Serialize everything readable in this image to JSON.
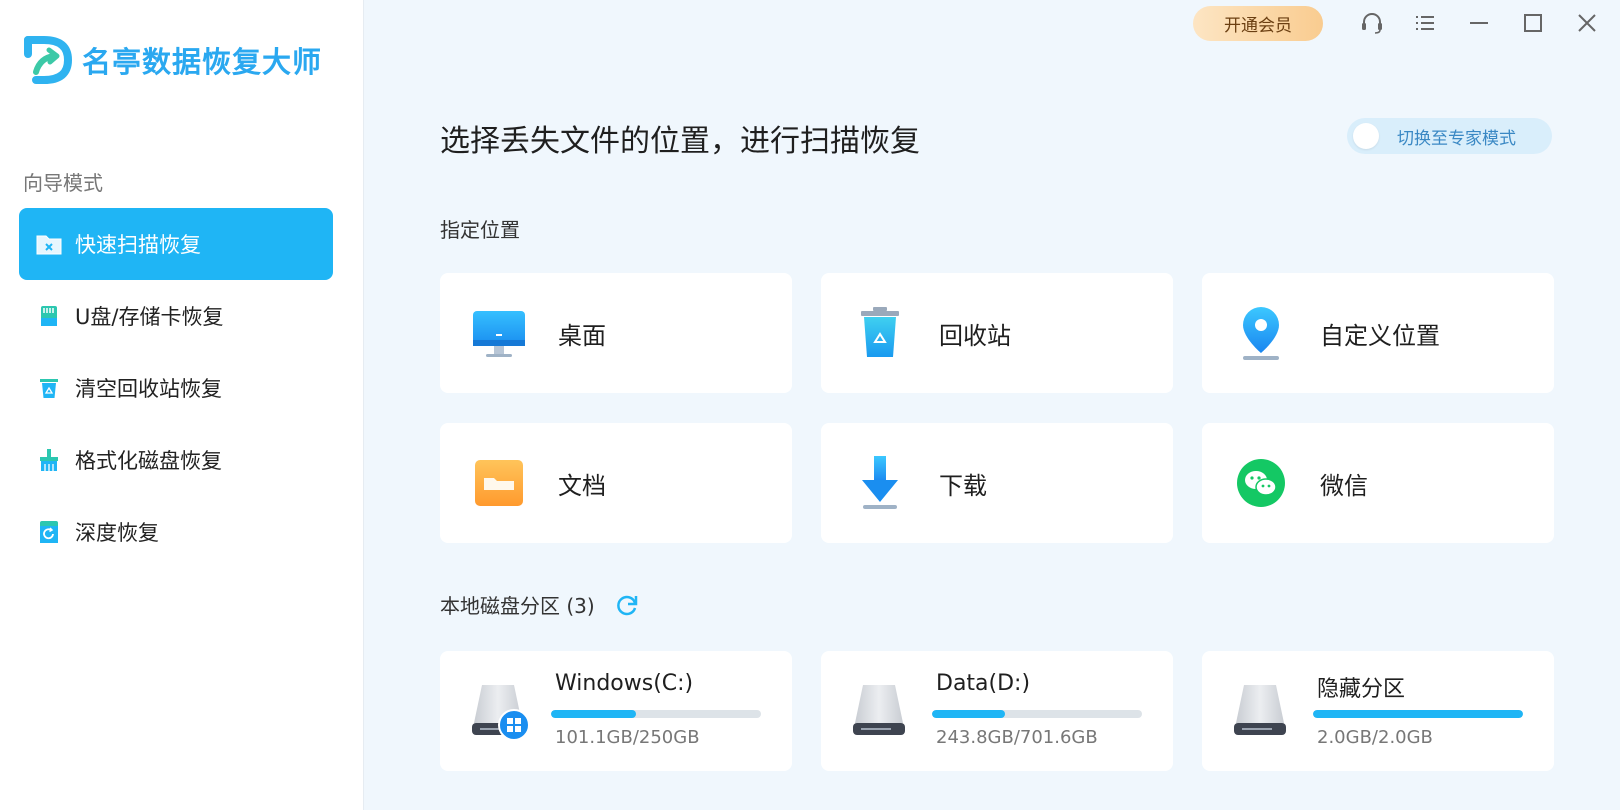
{
  "app": {
    "title": "名亭数据恢复大师"
  },
  "titlebar": {
    "vip_label": "开通会员"
  },
  "sidebar": {
    "section_label": "向导模式",
    "items": [
      {
        "label": "快速扫描恢复",
        "icon": "folder-scan-icon",
        "active": true
      },
      {
        "label": "U盘/存储卡恢复",
        "icon": "sd-card-icon",
        "active": false
      },
      {
        "label": "清空回收站恢复",
        "icon": "recycle-bin-icon",
        "active": false
      },
      {
        "label": "格式化磁盘恢复",
        "icon": "broom-icon",
        "active": false
      },
      {
        "label": "深度恢复",
        "icon": "deep-recovery-icon",
        "active": false
      }
    ]
  },
  "main": {
    "title": "选择丢失文件的位置，进行扫描恢复",
    "expert_toggle_label": "切换至专家模式",
    "locations_heading": "指定位置",
    "locations": [
      {
        "label": "桌面",
        "icon": "desktop-icon"
      },
      {
        "label": "回收站",
        "icon": "recycle-bin-icon"
      },
      {
        "label": "自定义位置",
        "icon": "location-pin-icon"
      },
      {
        "label": "文档",
        "icon": "folder-icon"
      },
      {
        "label": "下载",
        "icon": "download-icon"
      },
      {
        "label": "微信",
        "icon": "wechat-icon"
      }
    ],
    "disks_heading": "本地磁盘分区 (3)",
    "disks": [
      {
        "name": "Windows(C:)",
        "size": "101.1GB/250GB",
        "used_fraction": 0.404,
        "system": true
      },
      {
        "name": "Data(D:)",
        "size": "243.8GB/701.6GB",
        "used_fraction": 0.347,
        "system": false
      },
      {
        "name": "隐藏分区",
        "size": "2.0GB/2.0GB",
        "used_fraction": 1.0,
        "system": false
      }
    ]
  },
  "colors": {
    "accent": "#1fb5f5",
    "background": "#f0f7fd",
    "vip_gradient_start": "#fde5c3",
    "vip_gradient_end": "#f9cc90"
  }
}
